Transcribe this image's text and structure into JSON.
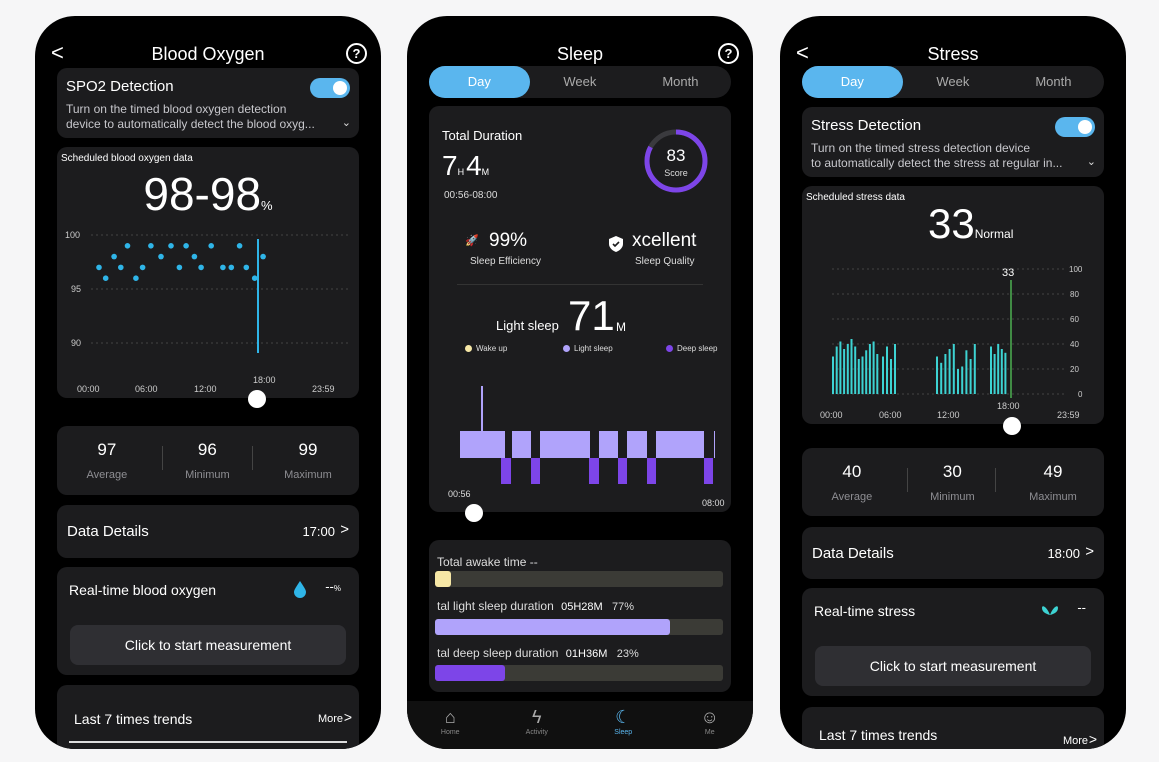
{
  "colors": {
    "accent": "#5ab6ee",
    "card": "#1c1c1e",
    "spo2_dot": "#2fb5e8",
    "stress_bar": "#3dd3d3",
    "light": "#b0a3fb",
    "deep": "#7d45e8",
    "wake": "#f6e7a6"
  },
  "oxygen": {
    "title": "Blood Oxygen",
    "back": "<",
    "help": "?",
    "detect_title": "SPO2 Detection",
    "detect_line1": "Turn on the timed blood oxygen detection",
    "detect_line2": "device to automatically detect the blood oxyg...",
    "chevron": "⌄",
    "chart_label": "Scheduled blood oxygen data",
    "value": "98-98",
    "unit": "%",
    "y_ticks": [
      "100",
      "95",
      "90"
    ],
    "x_ticks": [
      "00:00",
      "06:00",
      "12:00",
      "18:00",
      "23:59"
    ],
    "stats": [
      {
        "v": "97",
        "l": "Average"
      },
      {
        "v": "96",
        "l": "Minimum"
      },
      {
        "v": "99",
        "l": "Maximum"
      }
    ],
    "details_label": "Data Details",
    "details_time": "17:00",
    "arrow": ">",
    "realtime_label": "Real-time blood oxygen",
    "realtime_value": "--",
    "realtime_unit": "%",
    "measure_btn": "Click to start measurement",
    "trends_label": "Last 7 times trends",
    "more": "More"
  },
  "sleep": {
    "title": "Sleep",
    "help": "?",
    "tabs": [
      "Day",
      "Week",
      "Month"
    ],
    "total_label": "Total Duration",
    "hours": "7",
    "h": "H",
    "minutes": "4",
    "m": "M",
    "range": "00:56-08:00",
    "score": "83",
    "score_label": "Score",
    "efficiency": "99%",
    "efficiency_label": "Sleep Efficiency",
    "quality": "xcellent",
    "quality_label": "Sleep Quality",
    "stage_label": "Light sleep",
    "stage_value": "71",
    "stage_unit": "M",
    "legend": [
      "Wake up",
      "Light sleep",
      "Deep sleep"
    ],
    "start": "00:56",
    "end": "08:00",
    "awake_label": "Total awake time",
    "awake_value": "--",
    "light_label": "tal light sleep duration",
    "light_value": "05H28M",
    "light_pct": "77%",
    "deep_label": "tal deep sleep duration",
    "deep_value": "01H36M",
    "deep_pct": "23%",
    "nav": [
      "Home",
      "Activity",
      "Sleep",
      "Me"
    ]
  },
  "stress": {
    "title": "Stress",
    "back": "<",
    "tabs": [
      "Day",
      "Week",
      "Month"
    ],
    "detect_title": "Stress Detection",
    "detect_line1": "Turn on the timed stress detection device",
    "detect_line2": "to automatically detect the stress at regular in...",
    "chevron": "⌄",
    "chart_label": "Scheduled stress data",
    "value": "33",
    "level": "Normal",
    "marker": "33",
    "y_ticks": [
      "100",
      "80",
      "60",
      "40",
      "20",
      "0"
    ],
    "x_ticks": [
      "00:00",
      "06:00",
      "12:00",
      "18:00",
      "23:59"
    ],
    "stats": [
      {
        "v": "40",
        "l": "Average"
      },
      {
        "v": "30",
        "l": "Minimum"
      },
      {
        "v": "49",
        "l": "Maximum"
      }
    ],
    "details_label": "Data Details",
    "details_time": "18:00",
    "arrow": ">",
    "realtime_label": "Real-time stress",
    "realtime_value": "--",
    "measure_btn": "Click to start measurement",
    "trends_label": "Last 7 times trends",
    "more": "More"
  },
  "chart_data": [
    {
      "type": "scatter",
      "title": "Scheduled blood oxygen data",
      "ylim": [
        88,
        101
      ],
      "x": [
        "01:00",
        "01:40",
        "02:30",
        "03:10",
        "03:50",
        "04:40",
        "05:20",
        "06:10",
        "07:10",
        "08:10",
        "09:00",
        "09:40",
        "10:30",
        "11:10",
        "12:10",
        "13:20",
        "14:10",
        "15:00",
        "15:40",
        "16:30",
        "17:20"
      ],
      "values": [
        97,
        96,
        98,
        97,
        99,
        96,
        97,
        99,
        98,
        99,
        97,
        99,
        98,
        97,
        99,
        97,
        97,
        99,
        97,
        96,
        98
      ]
    },
    {
      "type": "bar",
      "title": "Scheduled stress data",
      "ylim": [
        0,
        100
      ],
      "x": [
        "00:00",
        "06:00",
        "12:00",
        "18:00",
        "23:59"
      ],
      "values": [
        30,
        38,
        42,
        36,
        40,
        44,
        38,
        28,
        30,
        35,
        40,
        42,
        32,
        30,
        38,
        28,
        40,
        30,
        25,
        32,
        36,
        40,
        20,
        22,
        35,
        28,
        40,
        38,
        32,
        40,
        36,
        33,
        38,
        30,
        25,
        38,
        40,
        42,
        36,
        32,
        22,
        26,
        40,
        36,
        28,
        38,
        30,
        42,
        25,
        32,
        33
      ]
    }
  ]
}
